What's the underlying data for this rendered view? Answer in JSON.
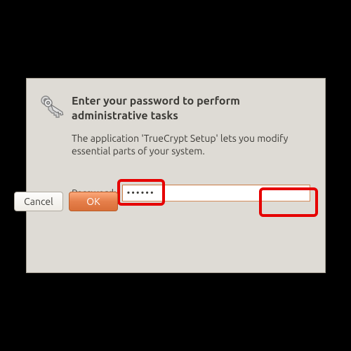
{
  "dialog": {
    "title": "Enter your password to perform administrative tasks",
    "description": "The application 'TrueCrypt Setup' lets you modify essential parts of your system.",
    "password_label": "Password:",
    "password_value": "••••••",
    "buttons": {
      "cancel": "Cancel",
      "ok": "OK"
    }
  },
  "icons": {
    "keys": "keys-icon"
  },
  "highlights": {
    "password_input": true,
    "ok_button": true
  },
  "colors": {
    "dialog_bg": "#dedbd5",
    "accent_orange": "#e57f4b",
    "focus_border": "#d38b5a",
    "highlight_red": "#e60000"
  }
}
